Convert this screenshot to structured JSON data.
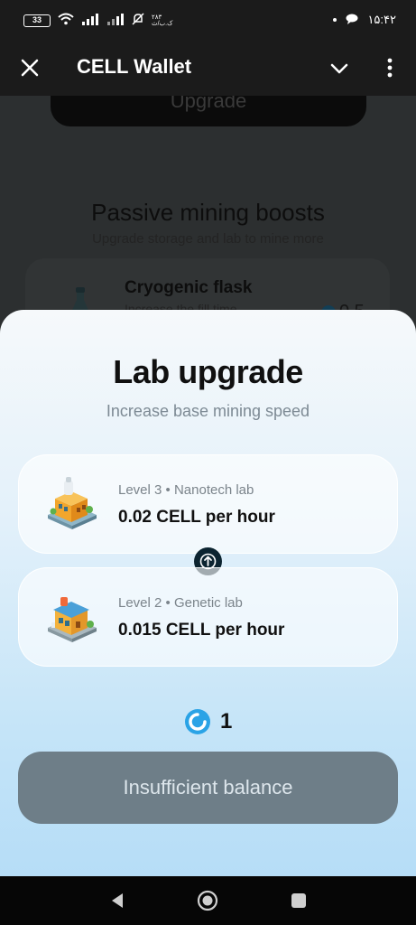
{
  "status_bar": {
    "battery": "33",
    "time": "۱۵:۴۲",
    "notif_text": "۲۸۳\nک.ب/ث"
  },
  "header": {
    "title": "CELL Wallet"
  },
  "background_page": {
    "upgrade_button": "Upgrade",
    "section_title": "Passive mining boosts",
    "section_subtitle": "Upgrade storage and lab to mine more",
    "item_title": "Cryogenic flask",
    "item_desc": "Increase the fill time",
    "item_cost": "0.5"
  },
  "sheet": {
    "title": "Lab upgrade",
    "subtitle": "Increase base mining speed",
    "next_level": {
      "level": "Level 3 • Nanotech lab",
      "rate": "0.02 CELL per hour"
    },
    "current_level": {
      "level": "Level 2 • Genetic lab",
      "rate": "0.015 CELL per hour"
    },
    "price": "1",
    "button_label": "Insufficient balance"
  },
  "colors": {
    "accent": "#2aa3e6",
    "button_disabled": "#6e7e88",
    "dark_badge": "#0c2430"
  }
}
